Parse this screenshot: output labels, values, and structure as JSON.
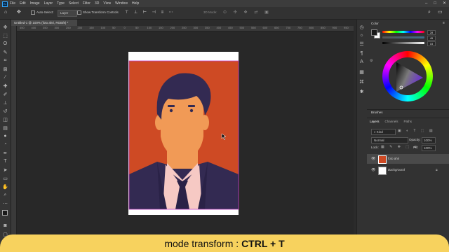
{
  "app": {
    "logo": "Ps"
  },
  "menu": [
    "File",
    "Edit",
    "Image",
    "Layer",
    "Type",
    "Select",
    "Filter",
    "3D",
    "View",
    "Window",
    "Help"
  ],
  "options": {
    "auto_select": "Auto-Select:",
    "auto_select_target": "Layer",
    "show_transform": "Show Transform Controls",
    "mode_3d": "3D Mode:"
  },
  "document": {
    "tab_title": "Untitled-1 @ 100% (foto ahri, RGB/8) *",
    "ruler_marks": [
      "450",
      "400",
      "350",
      "300",
      "250",
      "200",
      "150",
      "100",
      "50",
      "0",
      "50",
      "100",
      "150",
      "200",
      "250",
      "300",
      "350",
      "400",
      "450",
      "500",
      "550",
      "600",
      "650",
      "700",
      "750",
      "800",
      "850",
      "900",
      "950"
    ]
  },
  "panels": {
    "color_title": "Color",
    "color_values": {
      "h": "28",
      "s": "45",
      "b": "15"
    },
    "brushes_title": "Brushes",
    "layers_tabs": [
      "Layers",
      "Channels",
      "Paths"
    ],
    "kind": "Kind",
    "blend_mode": "Normal",
    "opacity_label": "Opacity:",
    "opacity_value": "100%",
    "lock_label": "Lock:",
    "fill_label": "Fill:",
    "fill_value": "100%",
    "layers": [
      {
        "name": "foto ahri"
      },
      {
        "name": "Background"
      }
    ]
  },
  "caption": {
    "prefix": "mode transform :",
    "shortcut": "CTRL + T"
  },
  "colors": {
    "canvas_bg": "#ce4a24",
    "skin": "#f19a56",
    "suit": "#332a52",
    "accent": "#31a8ff",
    "caption_bg": "#f7d25e"
  }
}
